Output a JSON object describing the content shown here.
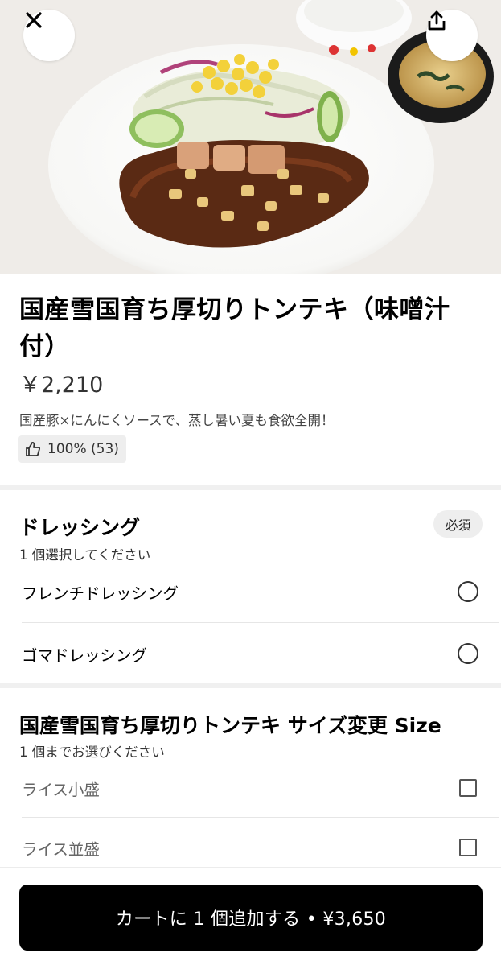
{
  "item": {
    "title": "国産雪国育ち厚切りトンテキ（味噌汁付）",
    "price": "￥2,210",
    "description": "国産豚×にんにくソースで、蒸し暑い夏も食欲全開！",
    "rating": "100% (53)"
  },
  "dressing": {
    "title": "ドレッシング",
    "subtitle": "1 個選択してください",
    "badge": "必須",
    "options": [
      {
        "label": "フレンチドレッシング"
      },
      {
        "label": "ゴマドレッシング"
      }
    ]
  },
  "size": {
    "title": "国産雪国育ち厚切りトンテキ サイズ変更 Size",
    "subtitle": "1 個までお選びください",
    "options": [
      {
        "label": "ライス小盛"
      },
      {
        "label": "ライス並盛"
      }
    ]
  },
  "cart": {
    "button_label": "カートに 1 個追加する • ¥3,650"
  },
  "icons": {
    "close": "close-icon",
    "share": "share-icon",
    "thumbs_up": "thumbs-up-icon"
  }
}
